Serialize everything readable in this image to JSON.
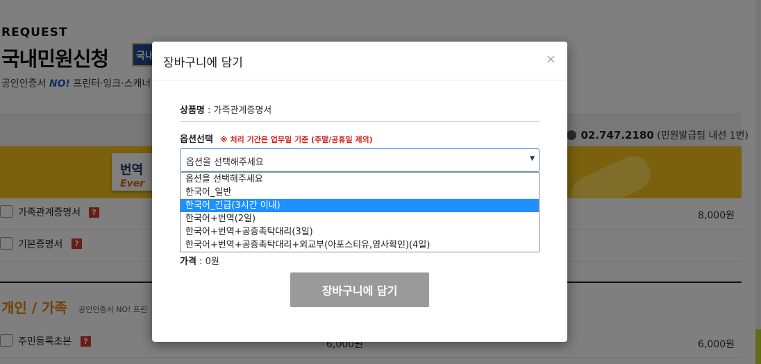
{
  "page": {
    "request_label": "REQUEST",
    "title": "국내민원신청",
    "badge_text": "국내",
    "subtitle_prefix": "공인인증서",
    "subtitle_no": "NO!",
    "subtitle_rest": "프린터·잉크·스캐너",
    "contact_phone": "02.747.2180",
    "contact_note": "(민원발급팀 내선 1번)",
    "banner_title": "번역",
    "banner_sub": "Ever",
    "rows": [
      {
        "label": "가족관계증명서",
        "price": "8,000원"
      },
      {
        "label": "기본증명서",
        "price": ""
      },
      {
        "label": "주민등록초본",
        "price": "6,000원"
      }
    ],
    "section_title": "개인 / 가족",
    "section_sub": "공인인증서 NO! 프린",
    "qmark": "?",
    "lower_mid_price": "6,000원"
  },
  "modal": {
    "title": "장바구니에 담기",
    "close_symbol": "×",
    "product_label": "상품명",
    "product_value": "가족관계증명서",
    "option_label": "옵션선택",
    "option_note": "※ 처리 기간은 업무일 기준 (주말/공휴일 제외)",
    "select_value": "옵션을 선택해주세요",
    "options": [
      "옵션을 선택해주세요",
      "한국어_일반",
      "한국어_긴급(3시간 이내)",
      "한국어+번역(2일)",
      "한국어+번역+공증촉탁대리(3일)",
      "한국어+번역+공증촉탁대리+외교부(아포스티유,영사확인)(4일)"
    ],
    "highlighted_option_index": 2,
    "price_label": "가격",
    "price_value": "0원",
    "cart_button": "장바구니에 담기"
  },
  "colors": {
    "highlight": "#1e90ff",
    "accent_orange": "#e0850b",
    "banner_yellow": "#f6c21b",
    "note_red": "#d0211c",
    "button_gray": "#9a9a9a"
  }
}
